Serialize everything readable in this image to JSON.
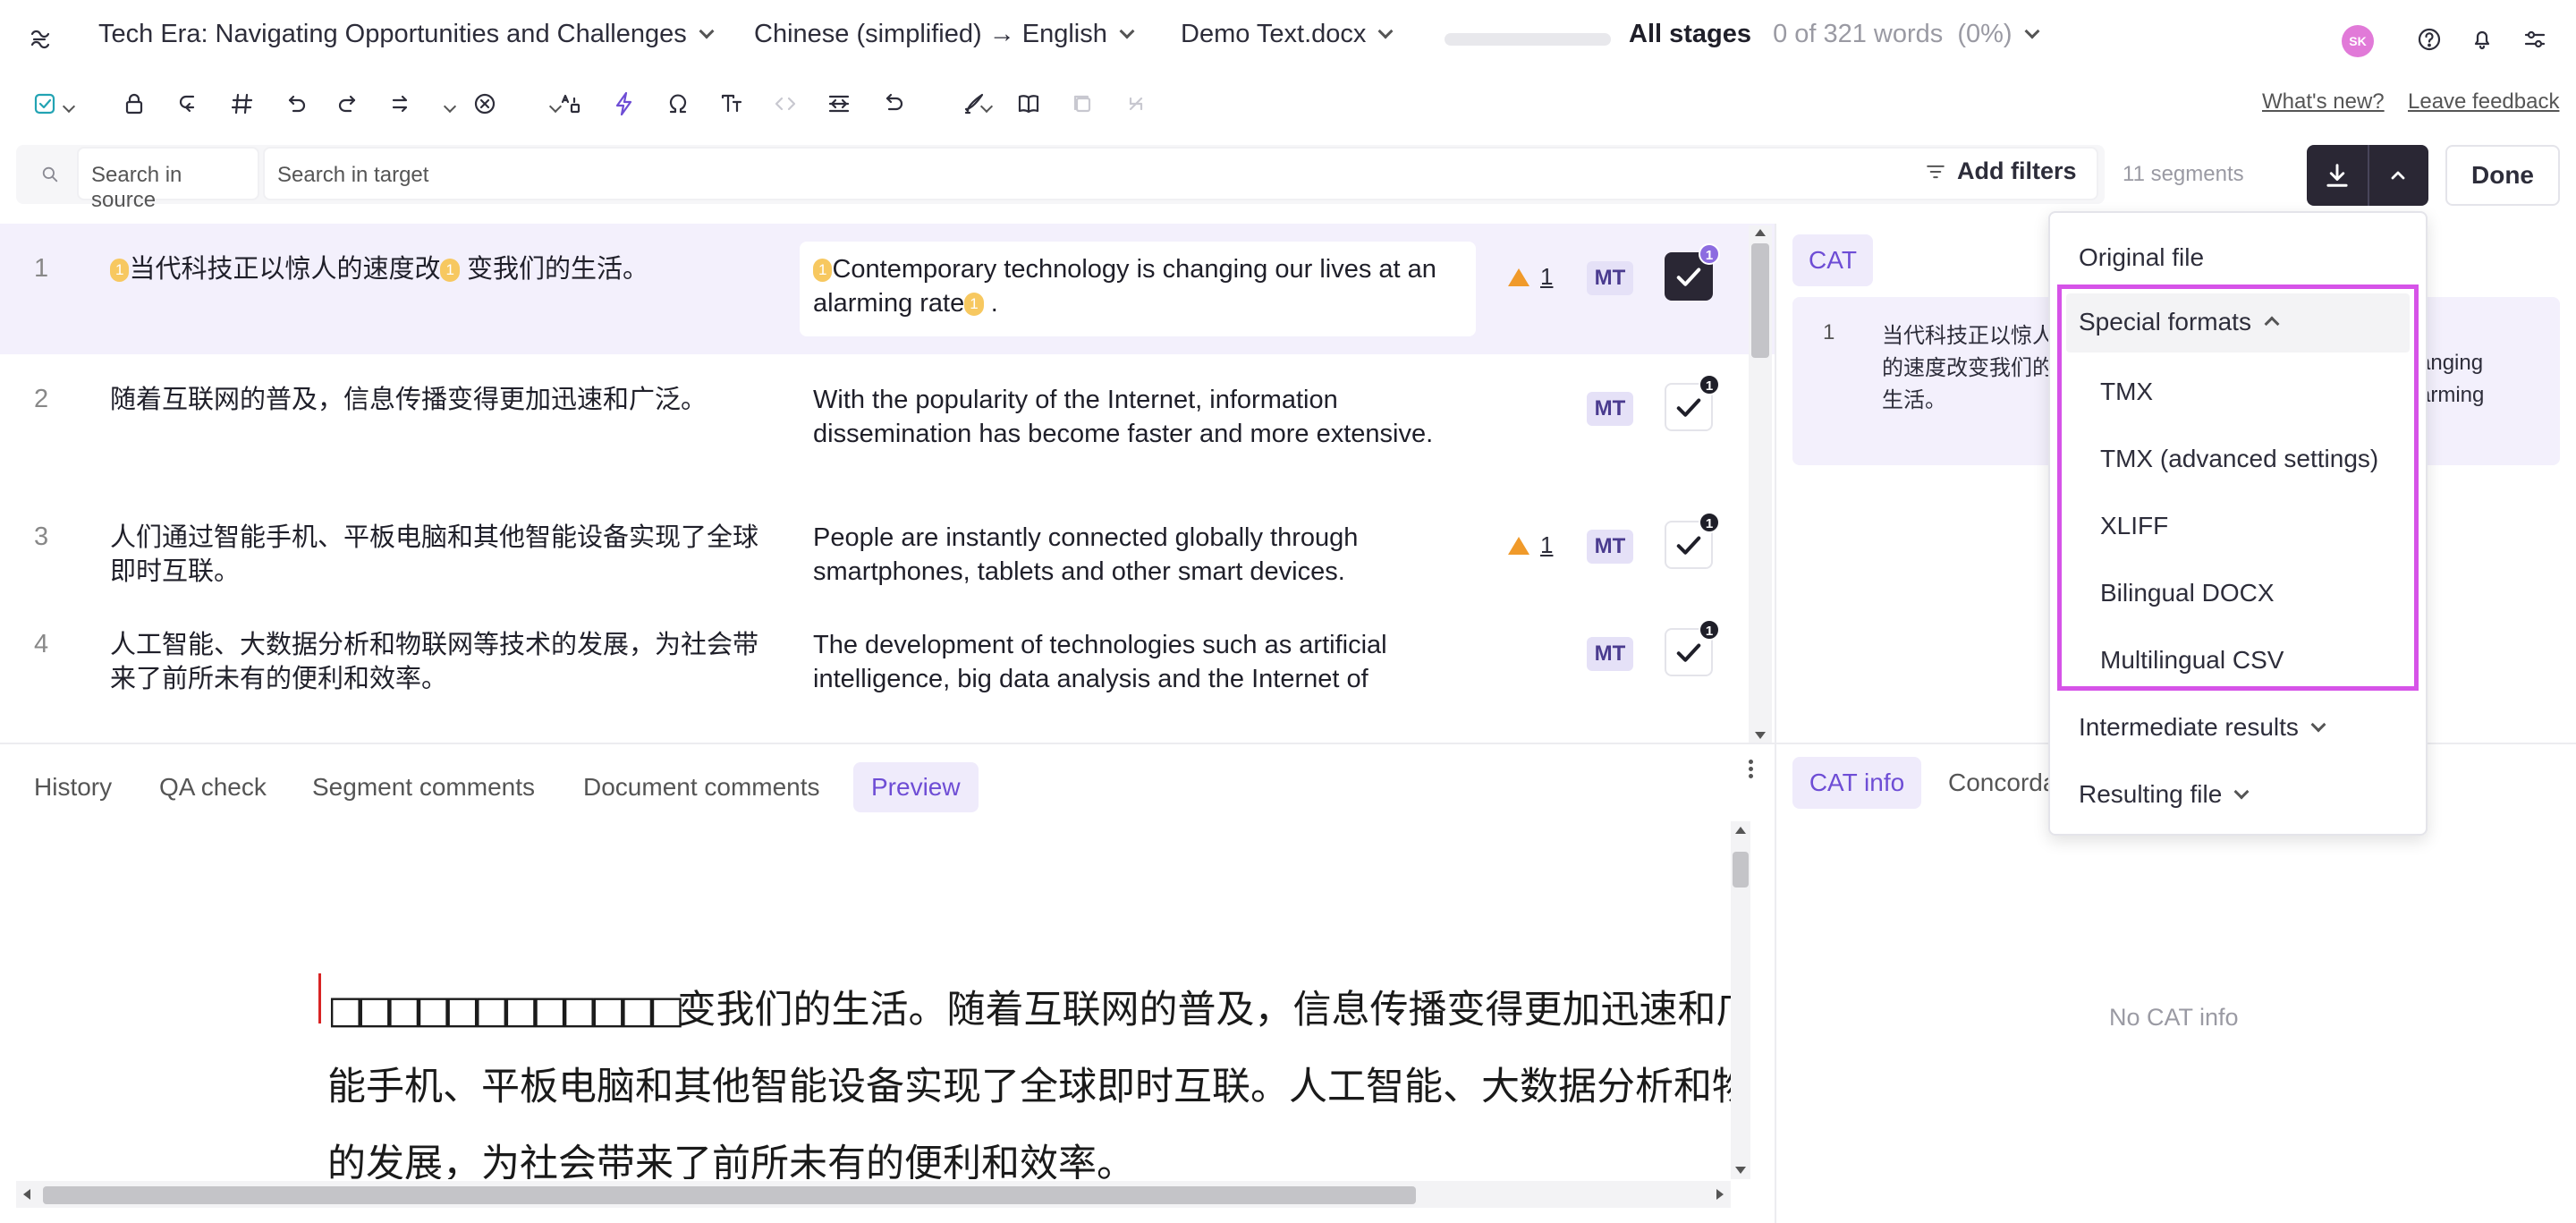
{
  "header": {
    "project_title": "Tech Era: Navigating Opportunities and Challenges",
    "language_pair": "Chinese (simplified) → English",
    "file_name": "Demo Text.docx",
    "progress_fraction": 0,
    "stage_label": "All stages",
    "word_count": "0 of 321 words",
    "percent": "(0%)",
    "avatar_initials": "SK"
  },
  "links": {
    "whats_new": "What's new?",
    "leave_feedback": "Leave feedback"
  },
  "toolbar_icons": [
    "confirm-icon",
    "lock-icon",
    "copy-source-icon",
    "hash-icon",
    "undo-icon",
    "redo-icon",
    "insert-icon",
    "clear-icon",
    "case-icon",
    "lightning-icon",
    "omega-icon",
    "text-format-icon",
    "code-icon",
    "join-icon",
    "revert-icon",
    "paint-icon",
    "book-icon",
    "copy-icon",
    "split-icon"
  ],
  "search": {
    "source_placeholder": "Search in source",
    "target_placeholder": "Search in target",
    "add_filters": "Add filters",
    "segment_count": "11 segments",
    "done_label": "Done"
  },
  "segments": [
    {
      "num": "1",
      "source": "当代科技正以惊人的速度改变我们的生活。",
      "target": "Contemporary technology is changing our lives at an alarming rate .",
      "warnings": "1",
      "mt": "MT",
      "confirm_badge": "1"
    },
    {
      "num": "2",
      "source": "随着互联网的普及，信息传播变得更加迅速和广泛。",
      "target": "With the popularity of the Internet, information dissemination has become faster and more extensive.",
      "warnings": "",
      "mt": "MT",
      "confirm_badge": "1"
    },
    {
      "num": "3",
      "source": "人们通过智能手机、平板电脑和其他智能设备实现了全球即时互联。",
      "target": "People are instantly connected globally through smartphones, tablets and other smart devices.",
      "warnings": "1",
      "mt": "MT",
      "confirm_badge": "1"
    },
    {
      "num": "4",
      "source": "人工智能、大数据分析和物联网等技术的发展，为社会带来了前所未有的便利和效率。",
      "target": "The development of technologies such as artificial intelligence, big data analysis and the Internet of",
      "warnings": "",
      "mt": "MT",
      "confirm_badge": "1"
    }
  ],
  "seg1_parts": {
    "source_a": "当代科技正以惊人的速度改",
    "source_b": "变我们的生活。",
    "target_a": "Contemporary technology is changing our lives at an alarming rate",
    "target_b": "."
  },
  "tag_number": "1",
  "bottom_tabs": [
    "History",
    "QA check",
    "Segment comments",
    "Document comments",
    "Preview"
  ],
  "preview": {
    "line1_boxes": "□□□□□□□□□□□□",
    "line1": "变我们的生活。随着互联网的普及，信息传播变得更加迅速和广泛",
    "line2": "能手机、平板电脑和其他智能设备实现了全球即时互联。人工智能、大数据分析和物",
    "line3": "的发展，为社会带来了前所未有的便利和效率。"
  },
  "cat_panel": {
    "tab_label": "CAT",
    "row_num": "1",
    "row_text": "当代科技正以惊人的速度改变我们的生活。",
    "right_fragment_1": "anging",
    "right_fragment_2": "arming"
  },
  "cat_bottom": {
    "tab_cat_info": "CAT info",
    "tab_concordance": "Concordance",
    "empty_text": "No CAT info"
  },
  "download_menu": {
    "original_file": "Original file",
    "special_formats": "Special formats",
    "items": [
      "TMX",
      "TMX (advanced settings)",
      "XLIFF",
      "Bilingual DOCX",
      "Multilingual CSV"
    ],
    "intermediate": "Intermediate results",
    "resulting": "Resulting file"
  },
  "colors": {
    "accent": "#6e4dd5",
    "highlight_border": "#d653e8",
    "dark_button": "#2a2734",
    "mt_badge_bg": "#e5e1f7",
    "tag": "#f7c860",
    "warning": "#f09a2a"
  }
}
